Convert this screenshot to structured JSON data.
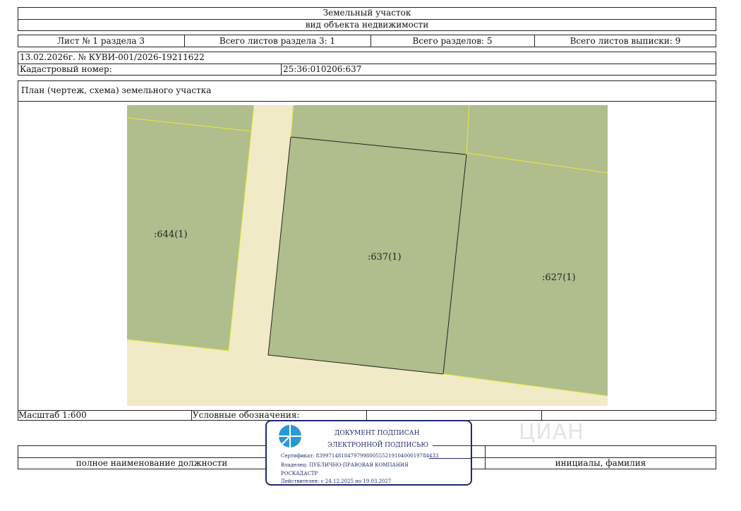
{
  "header": {
    "title": "Земельный участок",
    "subtitle": "вид объекта недвижимости"
  },
  "sheet_info": {
    "sheet": "Лист № 1 раздела 3",
    "total_sheets_section": "Всего листов раздела 3: 1",
    "total_sections": "Всего разделов: 5",
    "total_sheets_extract": "Всего листов выписки: 9"
  },
  "record": {
    "date_number": "13.02.2026г. № КУВИ-001/2026-19211622",
    "cadastral_label": "Кадастровый номер:",
    "cadastral_value": "25:36:010206:637"
  },
  "plan": {
    "title": "План (чертеж, схема) земельного участка",
    "parcels": [
      {
        "label": ":644(1)"
      },
      {
        "label": ":637(1)"
      },
      {
        "label": ":627(1)"
      }
    ],
    "colors": {
      "parcel": "#b0bd8c",
      "road": "#f0ebc6",
      "boundary": "#e8ea3a",
      "outline": "#222222"
    }
  },
  "footer": {
    "scale": "Масштаб 1:600",
    "legend": "Условные обозначения:",
    "position_caption": "полное наименование должности",
    "name_caption": "инициалы, фамилия"
  },
  "stamp": {
    "line1": "ДОКУМЕНТ ПОДПИСАН",
    "line2": "ЭЛЕКТРОННОЙ ПОДПИСЬЮ",
    "certificate": "Сертификат: 839971481847979980055521910400019784433",
    "owner": "Владелец: ПУБЛИЧНО-ПРАВОВАЯ КОМПАНИЯ",
    "owner2": "РОСКАДАСТР",
    "valid": "Действителен: с 24.12.2025 по 19.03.2027",
    "icon": "roskadastr-logo-icon",
    "color": "#1f2a6b"
  },
  "watermark": {
    "text": "ЦИАН"
  }
}
